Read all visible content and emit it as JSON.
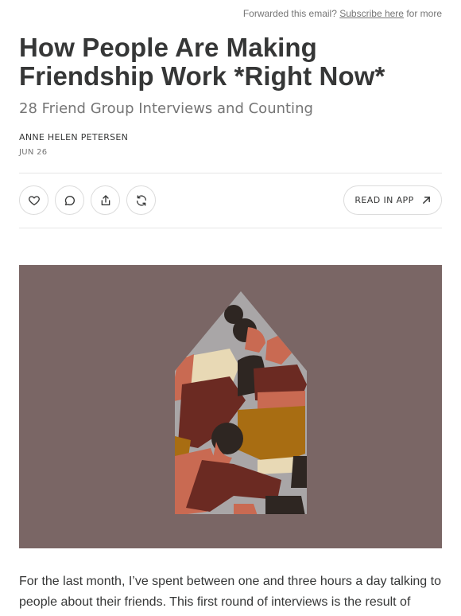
{
  "header": {
    "forward_prefix": "Forwarded this email?",
    "subscribe_link": "Subscribe here",
    "forward_suffix": "for more"
  },
  "post": {
    "title": "How People Are Making Friendship Work *Right Now*",
    "subtitle": "28 Friend Group Interviews and Counting",
    "author": "ANNE HELEN PETERSEN",
    "date": "JUN 26"
  },
  "actions": {
    "icons": [
      "heart-icon",
      "comment-icon",
      "share-icon",
      "restack-icon"
    ],
    "read_in_app_label": "READ IN APP"
  },
  "colors": {
    "hero_bg": "#7a6665",
    "house_bg": "#a9a6a7",
    "terracotta": "#c96a52",
    "maroon": "#6b2a22",
    "mustard": "#a86d12",
    "cream": "#e8d9b5",
    "dark": "#2e2622"
  },
  "body": {
    "text": "For the last month, I’ve spent between one and three hours a day talking to people about their friends. This first round of interviews is the result of people"
  }
}
